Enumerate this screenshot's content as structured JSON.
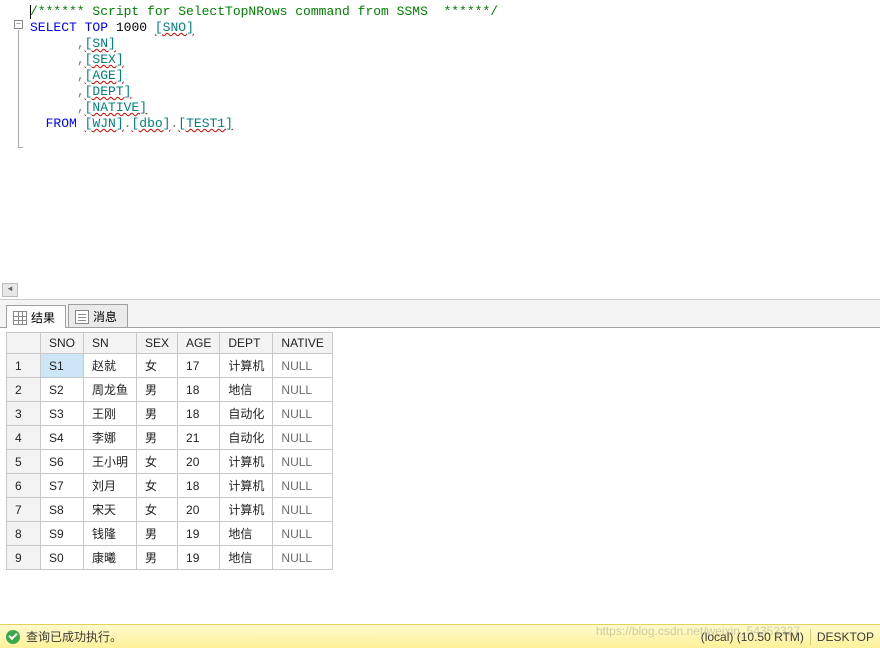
{
  "sql": {
    "comment": "/****** Script for SelectTopNRows command from SSMS  ******/",
    "kw_select": "SELECT",
    "kw_top": "TOP",
    "top_n": "1000",
    "col_sno": "[SNO]",
    "col_sn": "[SN]",
    "col_sex": "[SEX]",
    "col_age": "[AGE]",
    "col_dept": "[DEPT]",
    "col_native": "[NATIVE]",
    "kw_from": "FROM",
    "from_db": "[WJN]",
    "from_schema": "[dbo]",
    "from_table": "[TEST1]",
    "comma": ",",
    "dot": "."
  },
  "tabs": {
    "results": "结果",
    "messages": "消息"
  },
  "grid": {
    "headers": [
      "SNO",
      "SN",
      "SEX",
      "AGE",
      "DEPT",
      "NATIVE"
    ],
    "rows": [
      {
        "n": "1",
        "SNO": "S1",
        "SN": "赵就",
        "SEX": "女",
        "AGE": "17",
        "DEPT": "计算机",
        "NATIVE": "NULL"
      },
      {
        "n": "2",
        "SNO": "S2",
        "SN": "周龙鱼",
        "SEX": "男",
        "AGE": "18",
        "DEPT": "地信",
        "NATIVE": "NULL"
      },
      {
        "n": "3",
        "SNO": "S3",
        "SN": "王刚",
        "SEX": "男",
        "AGE": "18",
        "DEPT": "自动化",
        "NATIVE": "NULL"
      },
      {
        "n": "4",
        "SNO": "S4",
        "SN": "李娜",
        "SEX": "男",
        "AGE": "21",
        "DEPT": "自动化",
        "NATIVE": "NULL"
      },
      {
        "n": "5",
        "SNO": "S6",
        "SN": "王小明",
        "SEX": "女",
        "AGE": "20",
        "DEPT": "计算机",
        "NATIVE": "NULL"
      },
      {
        "n": "6",
        "SNO": "S7",
        "SN": "刘月",
        "SEX": "女",
        "AGE": "18",
        "DEPT": "计算机",
        "NATIVE": "NULL"
      },
      {
        "n": "7",
        "SNO": "S8",
        "SN": "宋天",
        "SEX": "女",
        "AGE": "20",
        "DEPT": "计算机",
        "NATIVE": "NULL"
      },
      {
        "n": "8",
        "SNO": "S9",
        "SN": "钱隆",
        "SEX": "男",
        "AGE": "19",
        "DEPT": "地信",
        "NATIVE": "NULL"
      },
      {
        "n": "9",
        "SNO": "S0",
        "SN": "康曦",
        "SEX": "男",
        "AGE": "19",
        "DEPT": "地信",
        "NATIVE": "NULL"
      }
    ]
  },
  "status": {
    "message": "查询已成功执行。",
    "server": "(local) (10.50 RTM)",
    "login": "DESKTOP"
  },
  "watermark": "https://blog.csdn.net/weixin_54352327"
}
